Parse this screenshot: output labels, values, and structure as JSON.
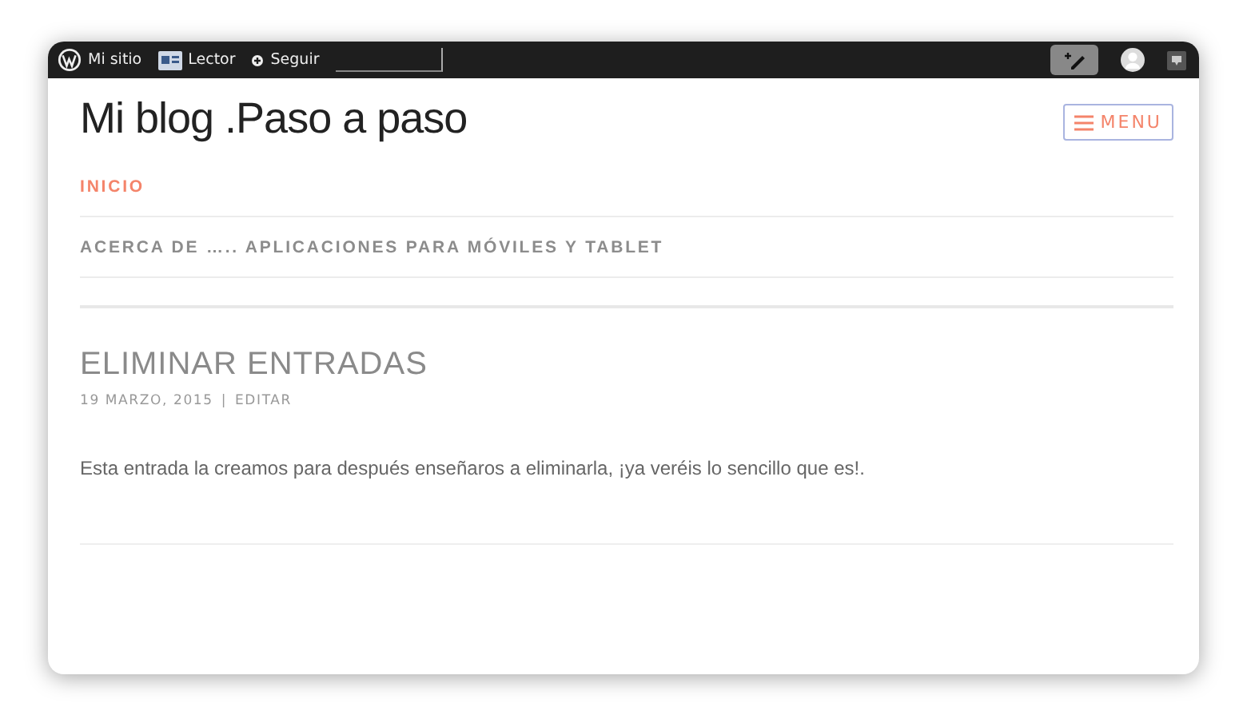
{
  "admin_bar": {
    "items": [
      {
        "kind": "site",
        "label": "Mi sitio"
      },
      {
        "kind": "reader",
        "label": "Lector"
      },
      {
        "kind": "follow",
        "label": "Seguir"
      }
    ]
  },
  "site_title": "Mi blog .Paso a paso",
  "menu_button": "MENU",
  "nav": [
    {
      "label": "INICIO",
      "selected": true
    },
    {
      "label": "ACERCA DE ….. APLICACIONES PARA MÓVILES Y TABLET",
      "selected": false
    }
  ],
  "post": {
    "title": "ELIMINAR ENTRADAS",
    "date": "19 MARZO, 2015",
    "separator": "|",
    "edit": "EDITAR",
    "body": "Esta entrada la creamos para después enseñaros a eliminarla, ¡ya veréis lo sencillo que es!."
  }
}
